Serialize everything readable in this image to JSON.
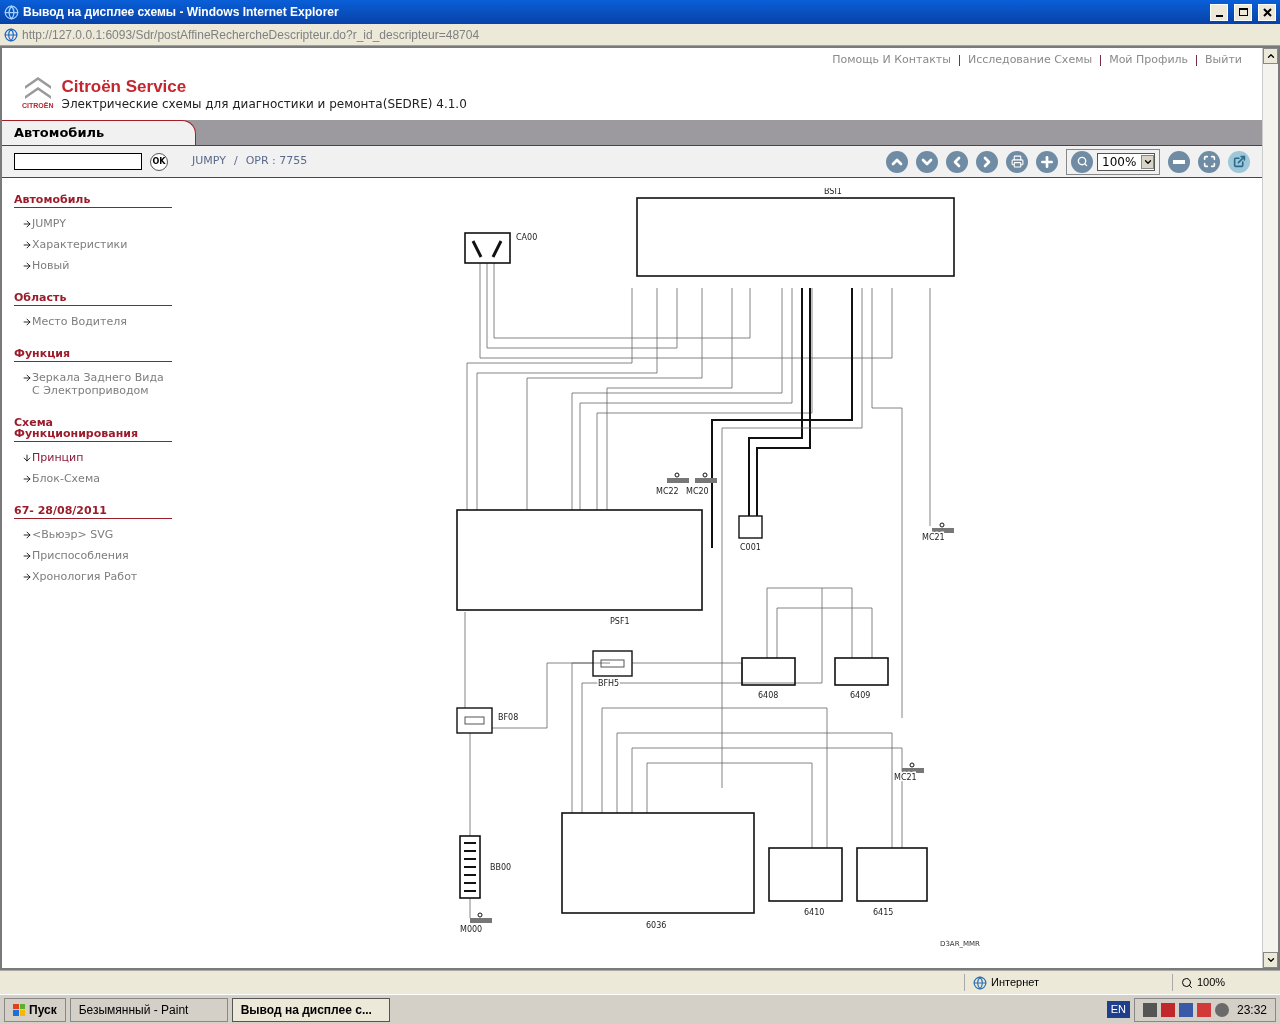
{
  "window": {
    "title": "Вывод на дисплее схемы - Windows Internet Explorer"
  },
  "address": {
    "value": "http://127.0.0.1:6093/Sdr/postAffineRechercheDescripteur.do?r_id_descripteur=48704"
  },
  "header": {
    "logo_text": "CITROËN",
    "brand": "Citroën Service",
    "subtitle": "Электрические схемы для диагностики и ремонта(SEDRE) 4.1.0",
    "links": [
      "Помощь И Контакты",
      "Исследование Схемы",
      "Мой Профиль",
      "Выйти"
    ]
  },
  "tab": {
    "label": "Автомобиль"
  },
  "toolbar": {
    "ok": "OK",
    "breadcrumb": [
      "JUMPY",
      "OPR : 7755"
    ],
    "breadcrumb_separator": "/",
    "zoom": "100%"
  },
  "sidebar": [
    {
      "title": "Автомобиль",
      "items": [
        {
          "label": "JUMPY",
          "selected": false
        },
        {
          "label": "Характеристики",
          "selected": false
        },
        {
          "label": "Новый",
          "selected": false
        }
      ]
    },
    {
      "title": "Область",
      "items": [
        {
          "label": "Место Водителя",
          "selected": false
        }
      ]
    },
    {
      "title": "Функция",
      "items": [
        {
          "label": "Зеркала Заднего Вида С Электроприводом",
          "selected": false
        }
      ]
    },
    {
      "title": "Схема Функционирования",
      "items": [
        {
          "label": "Принцип",
          "selected": true
        },
        {
          "label": "Блок-Схема",
          "selected": false
        }
      ]
    },
    {
      "title": "67- 28/08/2011",
      "items": [
        {
          "label": "<Вьюэр> SVG",
          "selected": false
        },
        {
          "label": "Приспособления",
          "selected": false
        },
        {
          "label": "Хронология Работ",
          "selected": false
        }
      ]
    }
  ],
  "diagram": {
    "components": [
      {
        "label": "BSI1",
        "kind": "module"
      },
      {
        "label": "CA00",
        "kind": "switch"
      },
      {
        "label": "PSF1",
        "kind": "module"
      },
      {
        "label": "C001",
        "kind": "connector"
      },
      {
        "label": "MC22",
        "kind": "ground"
      },
      {
        "label": "MC20",
        "kind": "ground"
      },
      {
        "label": "MC21",
        "kind": "ground"
      },
      {
        "label": "BFH5",
        "kind": "fuse"
      },
      {
        "label": "BF08",
        "kind": "fuse"
      },
      {
        "label": "BB00",
        "kind": "battery"
      },
      {
        "label": "M000",
        "kind": "ground"
      },
      {
        "label": "6036",
        "kind": "module"
      },
      {
        "label": "6408",
        "kind": "module"
      },
      {
        "label": "6409",
        "kind": "module"
      },
      {
        "label": "6410",
        "kind": "module"
      },
      {
        "label": "6415",
        "kind": "module"
      },
      {
        "label": "MC21",
        "kind": "ground"
      }
    ],
    "note": "D3AR_MMR"
  },
  "status_bar": {
    "zone": "Интернет",
    "zoom": "100%"
  },
  "taskbar": {
    "start": "Пуск",
    "tasks": [
      {
        "label": "Безымянный - Paint",
        "selected": false
      },
      {
        "label": "Вывод на дисплее с...",
        "selected": true
      }
    ],
    "language": "EN",
    "clock": "23:32"
  }
}
